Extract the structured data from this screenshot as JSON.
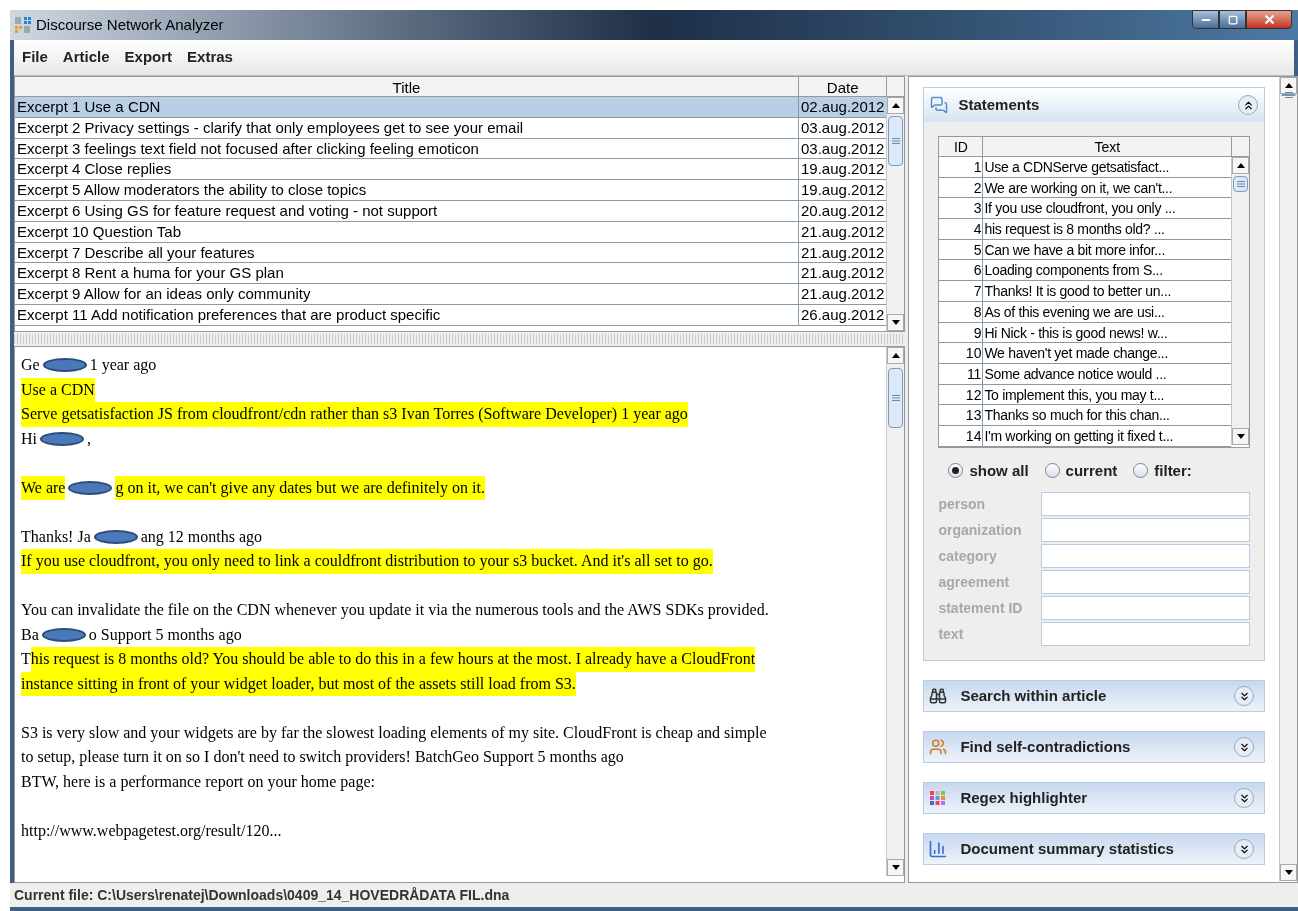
{
  "window": {
    "title": "Discourse Network Analyzer"
  },
  "menu": [
    "File",
    "Article",
    "Export",
    "Extras"
  ],
  "articles": {
    "columns": [
      "Title",
      "Date"
    ],
    "rows": [
      {
        "title": "Excerpt 1 Use a CDN",
        "date": "02.aug.2012",
        "selected": true
      },
      {
        "title": "Excerpt 2 Privacy settings - clarify that only employees get to see your email",
        "date": "03.aug.2012",
        "selected": false
      },
      {
        "title": "Excerpt 3 feelings text field not focused after clicking feeling emoticon",
        "date": "03.aug.2012",
        "selected": false
      },
      {
        "title": "Excerpt 4 Close replies",
        "date": "19.aug.2012",
        "selected": false
      },
      {
        "title": "Excerpt 5 Allow moderators the ability to close topics",
        "date": "19.aug.2012",
        "selected": false
      },
      {
        "title": "Excerpt 6 Using GS for feature request and voting - not support",
        "date": "20.aug.2012",
        "selected": false
      },
      {
        "title": "Excerpt 10 Question Tab",
        "date": "21.aug.2012",
        "selected": false
      },
      {
        "title": "Excerpt 7 Describe all your features",
        "date": "21.aug.2012",
        "selected": false
      },
      {
        "title": "Excerpt 8 Rent a huma for your GS plan",
        "date": "21.aug.2012",
        "selected": false
      },
      {
        "title": "Excerpt 9 Allow for an ideas only community",
        "date": "21.aug.2012",
        "selected": false
      },
      {
        "title": "Excerpt 11 Add notification preferences that are product specific",
        "date": "26.aug.2012",
        "selected": false
      }
    ]
  },
  "article_text": {
    "lines": [
      {
        "kind": "text",
        "segments": [
          {
            "kind": "text",
            "text": "Ge",
            "highlighted": false
          },
          {
            "kind": "redaction"
          },
          {
            "kind": "text",
            "text": "1 year ago",
            "highlighted": false
          }
        ]
      },
      {
        "kind": "text",
        "segments": [
          {
            "kind": "text",
            "text": "Use a CDN",
            "highlighted": true
          }
        ]
      },
      {
        "kind": "text",
        "segments": [
          {
            "kind": "text",
            "text": "Serve getsatisfaction JS from cloudfront/cdn rather than s3 Ivan Torres (Software Developer) 1 year ago",
            "highlighted": true
          }
        ]
      },
      {
        "kind": "text",
        "segments": [
          {
            "kind": "text",
            "text": "Hi",
            "highlighted": false
          },
          {
            "kind": "redaction"
          },
          {
            "kind": "text",
            "text": ",",
            "highlighted": false
          }
        ]
      },
      {
        "kind": "blank"
      },
      {
        "kind": "text",
        "segments": [
          {
            "kind": "text",
            "text": "We are",
            "highlighted": true
          },
          {
            "kind": "redaction"
          },
          {
            "kind": "text",
            "text": "g on it, we can't give any dates but we are definitely on it.",
            "highlighted": true
          }
        ]
      },
      {
        "kind": "blank"
      },
      {
        "kind": "text",
        "segments": [
          {
            "kind": "text",
            "text": "Thanks! Ja",
            "highlighted": false
          },
          {
            "kind": "redaction"
          },
          {
            "kind": "text",
            "text": "ang 12 months ago",
            "highlighted": false
          }
        ]
      },
      {
        "kind": "text",
        "segments": [
          {
            "kind": "text",
            "text": "If you use cloudfront, you only need to link a couldfront distribution to your s3 bucket. And it's all set to go.",
            "highlighted": true
          }
        ]
      },
      {
        "kind": "blank"
      },
      {
        "kind": "text",
        "segments": [
          {
            "kind": "text",
            "text": "You can invalidate the file on the CDN whenever you update it via the numerous tools and the AWS SDKs provided.",
            "highlighted": false
          }
        ]
      },
      {
        "kind": "text",
        "segments": [
          {
            "kind": "text",
            "text": "Ba",
            "highlighted": false
          },
          {
            "kind": "redaction"
          },
          {
            "kind": "text",
            "text": "o Support 5 months ago",
            "highlighted": false
          }
        ]
      },
      {
        "kind": "text",
        "segments": [
          {
            "kind": "text",
            "text": "T",
            "highlighted": false
          },
          {
            "kind": "text",
            "text": "his request is 8 months old? You should be able to do this in a few hours at the most. I already have a CloudFront",
            "highlighted": true
          }
        ]
      },
      {
        "kind": "text",
        "segments": [
          {
            "kind": "text",
            "text": "instance sitting in front of your widget loader, but most of the assets still load from S3.",
            "highlighted": true
          }
        ]
      },
      {
        "kind": "blank"
      },
      {
        "kind": "text",
        "segments": [
          {
            "kind": "text",
            "text": "S3 is very slow and your widgets are by far the slowest loading elements of my site. CloudFront is cheap and simple",
            "highlighted": false
          }
        ]
      },
      {
        "kind": "text",
        "segments": [
          {
            "kind": "text",
            "text": "to setup, please turn it on so I don't need to switch providers! BatchGeo Support 5 months ago",
            "highlighted": false
          }
        ]
      },
      {
        "kind": "text",
        "segments": [
          {
            "kind": "text",
            "text": "BTW, here is a performance report on your home page:",
            "highlighted": false
          }
        ]
      },
      {
        "kind": "blank"
      },
      {
        "kind": "text",
        "segments": [
          {
            "kind": "text",
            "text": "http://www.webpagetest.org/result/120...",
            "highlighted": false
          }
        ]
      }
    ]
  },
  "statements": {
    "title": "Statements",
    "expanded": true,
    "columns": [
      "ID",
      "Text"
    ],
    "rows": [
      {
        "id": "1",
        "text": "Use a CDNServe getsatisfact..."
      },
      {
        "id": "2",
        "text": "We are working on it, we can't..."
      },
      {
        "id": "3",
        "text": "If you use cloudfront, you only ..."
      },
      {
        "id": "4",
        "text": "his request is 8 months old? ..."
      },
      {
        "id": "5",
        "text": "Can we have a bit more infor..."
      },
      {
        "id": "6",
        "text": "Loading components from S..."
      },
      {
        "id": "7",
        "text": "Thanks! It is good to better un..."
      },
      {
        "id": "8",
        "text": "As of this evening we are usi..."
      },
      {
        "id": "9",
        "text": "Hi Nick - this is good news! w..."
      },
      {
        "id": "10",
        "text": "We haven't yet made change..."
      },
      {
        "id": "11",
        "text": "Some advance notice would ..."
      },
      {
        "id": "12",
        "text": "To implement this, you may t..."
      },
      {
        "id": "13",
        "text": "Thanks so much for this chan..."
      },
      {
        "id": "14",
        "text": "I'm working on getting it fixed t..."
      }
    ],
    "filter_options": [
      {
        "label": "show all",
        "selected": true
      },
      {
        "label": "current",
        "selected": false
      },
      {
        "label": "filter:",
        "selected": false
      }
    ],
    "fields": [
      {
        "label": "person",
        "disabled": true
      },
      {
        "label": "organization",
        "disabled": true
      },
      {
        "label": "category",
        "disabled": true
      },
      {
        "label": "agreement",
        "disabled": true
      },
      {
        "label": "statement ID",
        "disabled": true
      },
      {
        "label": "text",
        "disabled": true
      }
    ]
  },
  "panels": [
    {
      "kind": "search",
      "title": "Search within article",
      "expanded": false
    },
    {
      "kind": "contradictions",
      "title": "Find self-contradictions",
      "expanded": false
    },
    {
      "kind": "regex",
      "title": "Regex highlighter",
      "expanded": false
    },
    {
      "kind": "statistics",
      "title": "Document summary statistics",
      "expanded": false
    }
  ],
  "status_bar": "Current file: C:\\Users\\renatej\\Downloads\\0409_14_HOVEDRÅDATA FIL.dna"
}
